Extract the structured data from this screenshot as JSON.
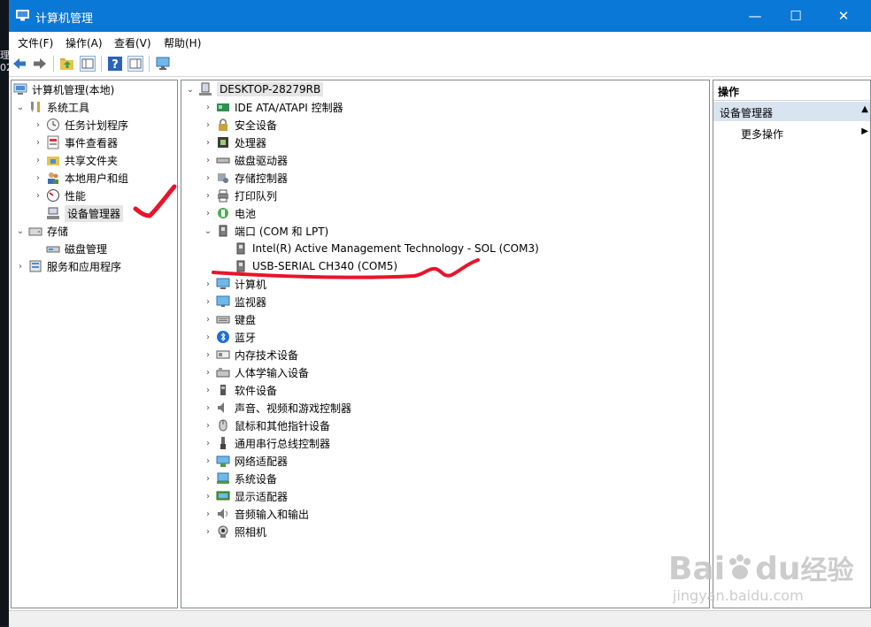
{
  "desktop": {
    "edge_text": [
      "理",
      "02"
    ]
  },
  "titlebar": {
    "title": "计算机管理",
    "minimize": "—",
    "maximize": "☐",
    "close": "✕"
  },
  "menu": [
    "文件(F)",
    "操作(A)",
    "查看(V)",
    "帮助(H)"
  ],
  "toolbar": {
    "buttons": [
      "back-arrow-icon",
      "forward-arrow-icon",
      "up-folder-icon",
      "show-hide-tree-icon",
      "help-icon",
      "properties-pane-icon",
      "monitor-icon"
    ]
  },
  "left_tree": {
    "root": "计算机管理(本地)",
    "system_tools": "系统工具",
    "task_scheduler": "任务计划程序",
    "event_viewer": "事件查看器",
    "shared_folders": "共享文件夹",
    "local_users": "本地用户和组",
    "performance": "性能",
    "device_manager": "设备管理器",
    "storage": "存储",
    "disk_management": "磁盘管理",
    "services_apps": "服务和应用程序"
  },
  "device_tree": {
    "computer": "DESKTOP-28279RB",
    "categories": [
      {
        "label": "IDE ATA/ATAPI 控制器",
        "icon": "ide-controller-icon"
      },
      {
        "label": "安全设备",
        "icon": "security-device-icon"
      },
      {
        "label": "处理器",
        "icon": "processor-icon"
      },
      {
        "label": "磁盘驱动器",
        "icon": "disk-drive-icon"
      },
      {
        "label": "存储控制器",
        "icon": "storage-controller-icon"
      },
      {
        "label": "打印队列",
        "icon": "printer-icon"
      },
      {
        "label": "电池",
        "icon": "battery-icon"
      },
      {
        "label": "端口 (COM 和 LPT)",
        "icon": "port-icon"
      },
      {
        "label": "计算机",
        "icon": "computer-icon"
      },
      {
        "label": "监视器",
        "icon": "monitor-icon"
      },
      {
        "label": "键盘",
        "icon": "keyboard-icon"
      },
      {
        "label": "蓝牙",
        "icon": "bluetooth-icon"
      },
      {
        "label": "内存技术设备",
        "icon": "memory-device-icon"
      },
      {
        "label": "人体学输入设备",
        "icon": "hid-icon"
      },
      {
        "label": "软件设备",
        "icon": "software-device-icon"
      },
      {
        "label": "声音、视频和游戏控制器",
        "icon": "sound-icon"
      },
      {
        "label": "鼠标和其他指针设备",
        "icon": "mouse-icon"
      },
      {
        "label": "通用串行总线控制器",
        "icon": "usb-icon"
      },
      {
        "label": "网络适配器",
        "icon": "network-adapter-icon"
      },
      {
        "label": "系统设备",
        "icon": "system-device-icon"
      },
      {
        "label": "显示适配器",
        "icon": "display-adapter-icon"
      },
      {
        "label": "音频输入和输出",
        "icon": "audio-io-icon"
      },
      {
        "label": "照相机",
        "icon": "camera-icon"
      }
    ],
    "port_children": [
      "Intel(R) Active Management Technology - SOL (COM3)",
      "USB-SERIAL CH340 (COM5)"
    ]
  },
  "actions": {
    "header": "操作",
    "section": "设备管理器",
    "more": "更多操作"
  },
  "watermark": {
    "brand_left": "Bai",
    "brand_right": "du",
    "brand_cn": "经验",
    "url": "jingyan.baidu.com"
  },
  "colors": {
    "titlebar": "#0a78d7",
    "annotation": "#e8142a",
    "section_bg": "#d9e4f1"
  }
}
